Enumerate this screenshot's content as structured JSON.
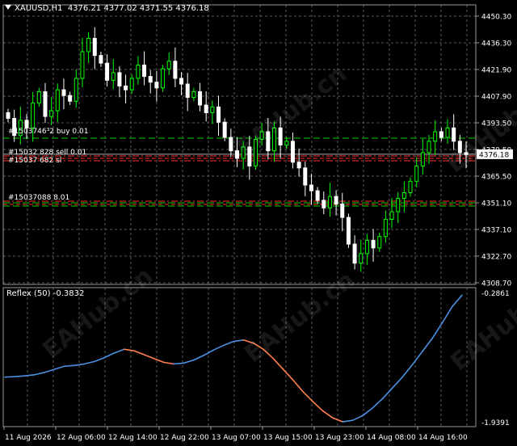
{
  "header": {
    "symbol_tf": "XAUUSD,H1",
    "ohlc": "4376.21 4377.02 4371.55 4376.18"
  },
  "price_axis": [
    "4450.30",
    "4436.30",
    "4421.90",
    "4407.90",
    "4393.50",
    "4379.50",
    "4365.50",
    "4351.10",
    "4337.10",
    "4322.70",
    "4308.70"
  ],
  "current_price": "4376.18",
  "time_axis": [
    "11 Aug 2026",
    "12 Aug 06:00",
    "12 Aug 14:00",
    "12 Aug 22:00",
    "13 Aug 07:00",
    "13 Aug 15:00",
    "13 Aug 23:00",
    "14 Aug 08:00",
    "14 Aug 16:00"
  ],
  "indicator": {
    "label": "Reflex (50) -0.3832",
    "top_value": "-0.2861",
    "bottom_value": "-1.9391"
  },
  "order_labels": [
    {
      "text": "#1503746³2 buy 0.01"
    },
    {
      "text": "#15032 828 sell 0.01"
    },
    {
      "text": "#15037 682 sl"
    },
    {
      "text": "#15037088 8.01"
    }
  ],
  "colors": {
    "bull": "#00ff00",
    "bear": "#ffffff",
    "grid": "#5a5a5a",
    "reflex_up": "#4a90e2",
    "reflex_down": "#ff7f50",
    "order_buy": "#00cc00",
    "order_sell": "#ff3030"
  },
  "watermark": "EAHub.cn",
  "chart_data": {
    "type": "candlestick",
    "symbol": "XAUUSD",
    "timeframe": "H1",
    "ylim": [
      4308.7,
      4450.3
    ],
    "closes": [
      4395,
      4386,
      4394,
      4390,
      4403,
      4409,
      4396,
      4399,
      4410,
      4407,
      4404,
      4416,
      4430,
      4437,
      4428,
      4424,
      4415,
      4419,
      4412,
      4410,
      4416,
      4423,
      4417,
      4414,
      4411,
      4421,
      4425,
      4416,
      4413,
      4406,
      4409,
      4402,
      4398,
      4401,
      4393,
      4385,
      4378,
      4374,
      4380,
      4370,
      4384,
      4388,
      4378,
      4390,
      4381,
      4383,
      4372,
      4369,
      4360,
      4357,
      4352,
      4348,
      4354,
      4350,
      4343,
      4329,
      4319,
      4324,
      4331,
      4327,
      4333,
      4342,
      4346,
      4353,
      4356,
      4362,
      4370,
      4377,
      4383,
      4388,
      4385,
      4390,
      4383,
      4377,
      4376
    ],
    "reflex": {
      "ylim": [
        -1.9391,
        -0.2861
      ],
      "values": [
        -1.36,
        -1.355,
        -1.345,
        -1.33,
        -1.3,
        -1.26,
        -1.22,
        -1.21,
        -1.19,
        -1.16,
        -1.11,
        -1.05,
        -1.0,
        -1.02,
        -1.07,
        -1.12,
        -1.17,
        -1.19,
        -1.18,
        -1.14,
        -1.08,
        -1.01,
        -0.95,
        -0.9,
        -0.88,
        -0.92,
        -1.0,
        -1.12,
        -1.26,
        -1.4,
        -1.55,
        -1.68,
        -1.8,
        -1.89,
        -1.94,
        -1.92,
        -1.86,
        -1.76,
        -1.64,
        -1.5,
        -1.36,
        -1.2,
        -1.03,
        -0.86,
        -0.66,
        -0.45,
        -0.3
      ]
    }
  }
}
